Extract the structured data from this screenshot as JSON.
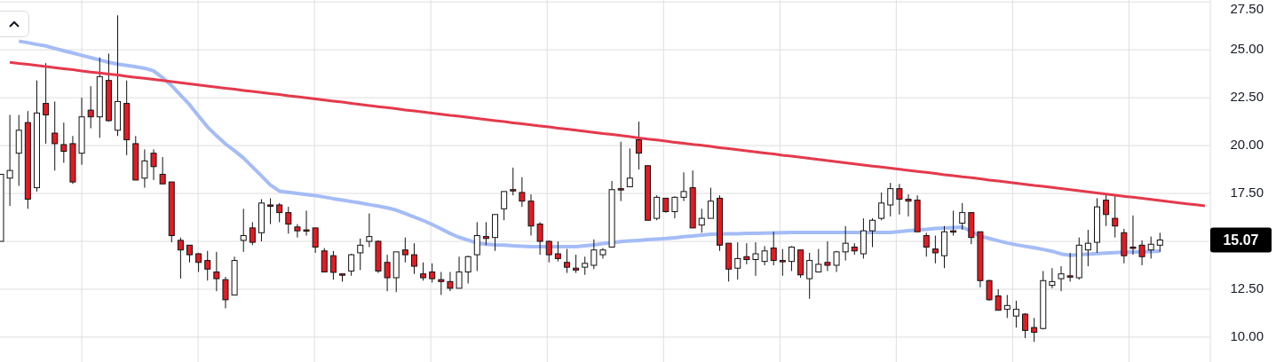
{
  "chart": {
    "chart_data": {
      "type": "candlestick",
      "ylim": [
        8.7,
        27.6
      ],
      "grid": true,
      "yticks": [
        {
          "value": 10,
          "label": "10.00"
        },
        {
          "value": 12.5,
          "label": "12.50"
        },
        {
          "value": 17.5,
          "label": "17.50"
        },
        {
          "value": 20,
          "label": "20.00"
        },
        {
          "value": 22.5,
          "label": "22.50"
        },
        {
          "value": 25,
          "label": "25.00"
        },
        {
          "value": 27.5,
          "label": "27.50"
        }
      ],
      "categories": [
        null,
        null,
        null,
        null,
        null,
        null,
        null,
        null,
        null,
        null,
        null,
        null,
        null,
        null,
        null,
        null,
        null,
        null,
        null,
        null,
        null,
        null,
        null,
        null,
        null,
        null,
        null,
        null,
        null,
        null,
        null,
        null,
        null,
        null,
        null,
        null,
        null,
        null,
        null,
        null,
        null,
        null,
        null,
        null,
        null,
        null,
        null,
        null,
        null,
        null,
        null,
        null,
        null,
        null,
        null,
        null,
        null,
        null,
        null,
        null,
        null,
        null,
        null,
        null,
        null,
        null,
        null,
        null,
        null,
        null,
        null,
        null,
        null,
        null,
        null,
        null,
        null,
        null,
        null,
        null,
        null,
        null,
        null,
        null,
        null,
        null,
        null,
        null,
        null,
        null,
        null,
        null,
        null,
        null,
        null,
        null,
        null,
        null,
        null,
        null,
        null,
        null,
        null,
        null,
        null,
        null,
        null,
        null,
        null,
        null,
        null,
        null,
        null,
        null,
        null,
        null,
        null,
        null,
        null,
        null,
        null,
        null,
        null,
        null,
        null,
        null,
        null,
        null,
        null,
        null,
        null,
        null,
        null,
        null,
        null
      ],
      "ohlc": [
        [
          15.0,
          18.5,
          15.0,
          18.5
        ],
        [
          18.3,
          21.6,
          16.85,
          18.7
        ],
        [
          19.6,
          21.6,
          17.9,
          20.8
        ],
        [
          21.2,
          21.8,
          16.7,
          17.2
        ],
        [
          17.8,
          23.4,
          17.6,
          21.7
        ],
        [
          22.2,
          24.3,
          20.1,
          21.6
        ],
        [
          20.65,
          22.3,
          18.7,
          20.1
        ],
        [
          20.05,
          21.2,
          19.1,
          19.7
        ],
        [
          20.1,
          20.5,
          18.0,
          18.1
        ],
        [
          19.6,
          22.5,
          19.0,
          21.5
        ],
        [
          21.85,
          23.1,
          20.9,
          21.5
        ],
        [
          21.5,
          24.6,
          20.4,
          23.6
        ],
        [
          23.4,
          24.8,
          21.25,
          21.3
        ],
        [
          20.8,
          26.8,
          20.5,
          22.3
        ],
        [
          22.2,
          23.4,
          19.5,
          20.3
        ],
        [
          20.1,
          20.5,
          18.2,
          18.2
        ],
        [
          18.3,
          19.8,
          17.8,
          19.2
        ],
        [
          19.6,
          19.8,
          18.2,
          18.9
        ],
        [
          18.5,
          19.4,
          18.0,
          18.0
        ],
        [
          18.1,
          18.1,
          14.95,
          15.3
        ],
        [
          15.05,
          15.2,
          13.05,
          14.55
        ],
        [
          14.8,
          14.8,
          13.9,
          14.3
        ],
        [
          14.35,
          14.4,
          13.4,
          13.9
        ],
        [
          14.0,
          14.5,
          12.95,
          13.55
        ],
        [
          13.4,
          14.45,
          12.4,
          13.05
        ],
        [
          13.0,
          13.15,
          11.5,
          11.95
        ],
        [
          12.2,
          14.2,
          12.2,
          14.0
        ],
        [
          15.05,
          16.7,
          14.45,
          15.3
        ],
        [
          15.7,
          16.0,
          14.8,
          14.95
        ],
        [
          15.45,
          17.2,
          15.0,
          17.0
        ],
        [
          16.9,
          17.25,
          15.9,
          16.85
        ],
        [
          16.9,
          17.0,
          16.0,
          16.5
        ],
        [
          16.5,
          16.8,
          15.4,
          15.9
        ],
        [
          15.75,
          15.9,
          15.2,
          15.55
        ],
        [
          15.6,
          16.6,
          15.3,
          15.57
        ],
        [
          15.7,
          15.7,
          14.4,
          14.7
        ],
        [
          14.5,
          14.65,
          13.4,
          13.4
        ],
        [
          14.25,
          14.5,
          13.0,
          13.38
        ],
        [
          13.3,
          13.3,
          12.9,
          13.25
        ],
        [
          13.45,
          14.35,
          13.2,
          14.3
        ],
        [
          14.4,
          15.15,
          13.5,
          14.8
        ],
        [
          15.0,
          16.45,
          14.7,
          15.25
        ],
        [
          15.0,
          15.05,
          13.35,
          13.45
        ],
        [
          13.9,
          14.3,
          12.4,
          13.1
        ],
        [
          13.1,
          14.45,
          12.35,
          14.45
        ],
        [
          14.55,
          15.2,
          13.9,
          14.3
        ],
        [
          14.3,
          14.9,
          13.3,
          13.7
        ],
        [
          13.3,
          13.9,
          12.95,
          13.1
        ],
        [
          13.4,
          13.85,
          12.85,
          13.05
        ],
        [
          13.0,
          13.4,
          12.2,
          12.9
        ],
        [
          12.9,
          13.4,
          12.4,
          12.55
        ],
        [
          12.55,
          14.2,
          12.55,
          13.4
        ],
        [
          13.4,
          14.25,
          12.8,
          14.2
        ],
        [
          14.3,
          16.0,
          13.45,
          15.3
        ],
        [
          15.25,
          16.0,
          14.8,
          15.15
        ],
        [
          15.2,
          16.4,
          14.5,
          16.4
        ],
        [
          16.7,
          17.6,
          16.1,
          17.6
        ],
        [
          17.7,
          18.85,
          17.4,
          17.65
        ],
        [
          17.55,
          18.35,
          16.8,
          17.1
        ],
        [
          17.1,
          17.45,
          15.3,
          15.8
        ],
        [
          15.9,
          16.0,
          14.3,
          15.0
        ],
        [
          15.0,
          15.05,
          13.9,
          14.3
        ],
        [
          14.35,
          15.0,
          13.95,
          14.1
        ],
        [
          13.9,
          14.6,
          13.35,
          13.65
        ],
        [
          13.6,
          14.3,
          13.35,
          13.5
        ],
        [
          13.65,
          14.2,
          13.25,
          13.85
        ],
        [
          13.75,
          15.1,
          13.55,
          14.55
        ],
        [
          14.3,
          14.65,
          14.1,
          14.55
        ],
        [
          14.7,
          18.15,
          14.7,
          17.7
        ],
        [
          17.75,
          20.2,
          17.1,
          17.72
        ],
        [
          17.85,
          19.85,
          17.85,
          18.3
        ],
        [
          20.3,
          21.25,
          18.75,
          19.6
        ],
        [
          18.95,
          18.95,
          16.1,
          16.1
        ],
        [
          16.2,
          17.4,
          16.1,
          17.3
        ],
        [
          17.25,
          17.25,
          16.5,
          16.55
        ],
        [
          16.55,
          17.35,
          16.2,
          17.3
        ],
        [
          17.3,
          18.6,
          17.1,
          17.6
        ],
        [
          17.8,
          18.7,
          15.7,
          15.7
        ],
        [
          15.85,
          16.7,
          15.45,
          16.2
        ],
        [
          16.2,
          17.8,
          16.2,
          17.1
        ],
        [
          17.25,
          17.4,
          14.5,
          14.8
        ],
        [
          14.9,
          14.9,
          12.9,
          13.55
        ],
        [
          13.6,
          14.95,
          13.0,
          14.1
        ],
        [
          14.2,
          14.9,
          13.8,
          14.05
        ],
        [
          14.05,
          14.95,
          13.2,
          14.35
        ],
        [
          13.95,
          14.75,
          13.75,
          14.5
        ],
        [
          14.65,
          15.5,
          13.75,
          14.0
        ],
        [
          14.0,
          14.6,
          13.2,
          13.98
        ],
        [
          13.95,
          14.75,
          13.45,
          14.7
        ],
        [
          14.55,
          14.55,
          13.1,
          13.25
        ],
        [
          13.05,
          14.4,
          12.0,
          14.0
        ],
        [
          13.4,
          14.6,
          13.4,
          13.8
        ],
        [
          13.9,
          15.0,
          13.45,
          13.75
        ],
        [
          13.75,
          14.5,
          13.4,
          14.45
        ],
        [
          14.45,
          15.8,
          14.0,
          14.9
        ],
        [
          14.7,
          14.9,
          14.3,
          14.5
        ],
        [
          14.35,
          16.2,
          14.1,
          15.55
        ],
        [
          15.55,
          16.2,
          14.7,
          16.1
        ],
        [
          16.2,
          17.55,
          16.1,
          17.0
        ],
        [
          16.9,
          18.05,
          16.3,
          17.75
        ],
        [
          17.75,
          18.0,
          16.4,
          17.2
        ],
        [
          17.2,
          17.45,
          16.3,
          17.1
        ],
        [
          17.15,
          17.4,
          15.5,
          15.5
        ],
        [
          15.3,
          15.45,
          14.2,
          14.7
        ],
        [
          14.6,
          15.3,
          13.85,
          14.4
        ],
        [
          14.25,
          15.8,
          13.6,
          15.5
        ],
        [
          15.55,
          16.6,
          15.3,
          15.52
        ],
        [
          15.95,
          17.0,
          15.6,
          16.5
        ],
        [
          16.5,
          16.5,
          14.85,
          15.2
        ],
        [
          15.5,
          15.5,
          12.6,
          12.95
        ],
        [
          12.95,
          13.0,
          11.9,
          11.95
        ],
        [
          12.15,
          12.5,
          11.4,
          11.4
        ],
        [
          11.45,
          12.2,
          11.0,
          11.65
        ],
        [
          11.1,
          11.9,
          10.5,
          11.45
        ],
        [
          11.2,
          11.25,
          9.95,
          10.35
        ],
        [
          10.5,
          11.0,
          9.75,
          10.25
        ],
        [
          10.45,
          13.45,
          10.4,
          12.95
        ],
        [
          12.7,
          13.6,
          12.55,
          12.9
        ],
        [
          13.05,
          13.7,
          12.4,
          13.3
        ],
        [
          13.2,
          14.4,
          12.9,
          13.15
        ],
        [
          13.1,
          15.2,
          13.0,
          14.8
        ],
        [
          14.55,
          15.6,
          13.7,
          14.9
        ],
        [
          14.95,
          17.25,
          14.4,
          16.8
        ],
        [
          17.15,
          17.45,
          15.8,
          16.4
        ],
        [
          16.2,
          17.4,
          15.2,
          15.8
        ],
        [
          15.45,
          15.65,
          13.85,
          14.25
        ],
        [
          14.7,
          16.35,
          14.3,
          14.65
        ],
        [
          14.8,
          15.05,
          13.75,
          14.2
        ],
        [
          14.55,
          15.25,
          14.1,
          14.85
        ],
        [
          14.8,
          15.45,
          14.45,
          15.07
        ],
        null,
        null,
        null,
        null,
        null
      ],
      "series": [
        {
          "type": "line",
          "color": "#a4bcf7",
          "values": [
            null,
            null,
            25.45,
            25.37,
            25.28,
            25.2,
            25.07,
            24.95,
            24.83,
            24.71,
            24.59,
            24.47,
            24.35,
            24.25,
            24.18,
            24.11,
            24.04,
            23.9,
            23.54,
            23.13,
            22.63,
            22.14,
            21.54,
            20.97,
            20.51,
            20.08,
            19.73,
            19.35,
            18.88,
            18.42,
            17.93,
            17.62,
            17.56,
            17.5,
            17.44,
            17.39,
            17.31,
            17.23,
            17.16,
            17.08,
            17.0,
            16.92,
            16.84,
            16.75,
            16.63,
            16.45,
            16.27,
            16.09,
            15.88,
            15.65,
            15.41,
            15.21,
            15.06,
            14.91,
            14.85,
            14.82,
            14.8,
            14.77,
            14.75,
            14.72,
            14.72,
            14.72,
            14.72,
            14.72,
            14.72,
            14.77,
            14.82,
            14.88,
            14.93,
            14.99,
            15.02,
            15.05,
            15.09,
            15.12,
            15.15,
            15.19,
            15.24,
            15.28,
            15.33,
            15.37,
            15.38,
            15.39,
            15.4,
            15.41,
            15.42,
            15.43,
            15.44,
            15.45,
            15.46,
            15.46,
            15.46,
            15.46,
            15.46,
            15.46,
            15.46,
            15.46,
            15.46,
            15.46,
            15.46,
            15.47,
            15.51,
            15.55,
            15.59,
            15.62,
            15.67,
            15.69,
            15.72,
            15.74,
            15.52,
            15.27,
            15.15,
            15.03,
            14.91,
            14.82,
            14.74,
            14.66,
            14.58,
            14.48,
            14.34,
            14.27,
            14.3,
            14.33,
            14.36,
            14.39,
            14.41,
            14.43,
            14.44,
            14.46,
            14.47,
            14.49,
            null,
            null,
            null,
            null,
            null
          ]
        },
        {
          "type": "line",
          "color": "#e5394c",
          "values": [
            null,
            24.35,
            24.29,
            24.24,
            24.18,
            24.12,
            24.07,
            24.01,
            23.96,
            23.9,
            23.84,
            23.79,
            23.73,
            23.68,
            23.62,
            23.56,
            23.51,
            23.45,
            23.4,
            23.34,
            23.28,
            23.22,
            23.16,
            23.11,
            23.05,
            22.99,
            22.94,
            22.88,
            22.83,
            22.77,
            22.71,
            22.66,
            22.6,
            22.55,
            22.49,
            22.43,
            22.38,
            22.32,
            22.27,
            22.21,
            22.15,
            22.09,
            22.03,
            21.98,
            21.92,
            21.86,
            21.81,
            21.75,
            21.7,
            21.64,
            21.58,
            21.53,
            21.47,
            21.42,
            21.36,
            21.3,
            21.25,
            21.19,
            21.14,
            21.08,
            21.02,
            20.97,
            20.91,
            20.86,
            20.8,
            20.74,
            20.69,
            20.63,
            20.58,
            20.52,
            20.46,
            20.4,
            20.34,
            20.29,
            20.23,
            20.17,
            20.12,
            20.06,
            20.01,
            19.95,
            19.89,
            19.84,
            19.78,
            19.73,
            19.67,
            19.61,
            19.56,
            19.5,
            19.45,
            19.39,
            19.33,
            19.27,
            19.21,
            19.16,
            19.1,
            19.04,
            18.99,
            18.93,
            18.88,
            18.82,
            18.76,
            18.71,
            18.65,
            18.6,
            18.54,
            18.48,
            18.43,
            18.37,
            18.32,
            18.26,
            18.2,
            18.15,
            18.09,
            18.04,
            17.98,
            17.92,
            17.87,
            17.81,
            17.76,
            17.7,
            17.64,
            17.58,
            17.52,
            17.47,
            17.41,
            17.35,
            17.3,
            17.24,
            17.19,
            17.13,
            17.07,
            17.02,
            16.96,
            16.91,
            16.85
          ]
        }
      ],
      "annotations": [
        {
          "text": "15.07"
        }
      ]
    }
  }
}
